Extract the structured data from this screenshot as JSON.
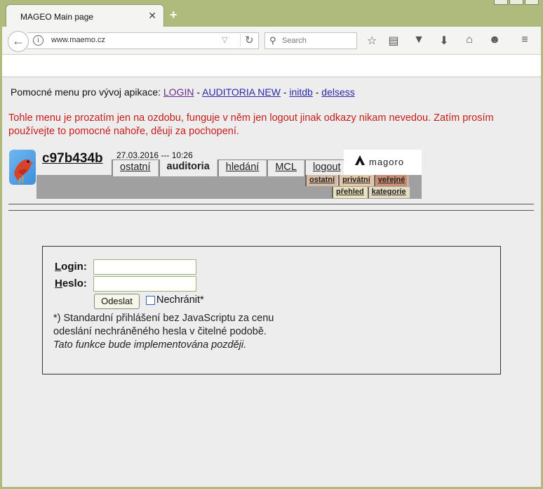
{
  "browser": {
    "tab_title": "MAGEO Main page",
    "tab_close": "✕",
    "new_tab": "+",
    "url": "www.maemo.cz",
    "search_placeholder": "Search"
  },
  "page": {
    "dev_menu": {
      "prefix": "Pomocné menu pro vývoj apikace:",
      "links": [
        "LOGIN",
        "AUDITORIA NEW",
        "initdb",
        "delsess"
      ],
      "separator": "-"
    },
    "warning": "Tohle menu je prozatím jen na ozdobu, funguje v něm jen logout jinak odkazy nikam nevedou. Zatím prosím používejte to pomocné nahoře, děuji za pochopení.",
    "header": {
      "username": "c97b434b",
      "datetime": "27.03.2016 --- 10:26",
      "tabs": [
        "ostatní",
        "auditoria",
        "hledání",
        "MCL",
        "logout"
      ],
      "active_tab": "auditoria",
      "logo_text": "magoro",
      "subtabs_row1": [
        "ostatní",
        "privátní",
        "veřejné"
      ],
      "subtabs_row2": [
        "přehled",
        "kategorie"
      ]
    },
    "login": {
      "login_label_first": "L",
      "login_label_rest": "ogin:",
      "password_label_first": "H",
      "password_label_rest": "eslo:",
      "login_value": "",
      "password_value": "",
      "submit_label": "Odeslat",
      "checkbox_label": "Nechránit*",
      "note_line1": "*) Standardní přihlášení bez JavaScriptu za cenu",
      "note_line2": "odeslání nechráněného hesla v čitelné podobě.",
      "note_line3": "Tato funkce bude implementována později."
    }
  }
}
